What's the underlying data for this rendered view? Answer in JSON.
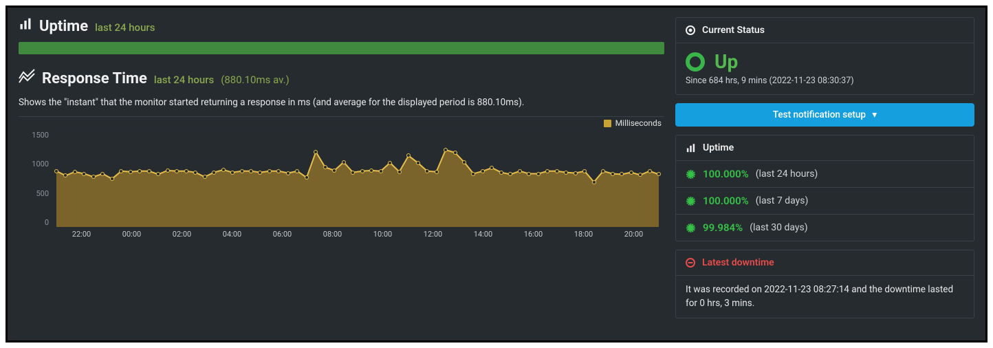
{
  "uptime_section": {
    "title": "Uptime",
    "subtitle": "last 24 hours"
  },
  "response_time": {
    "title": "Response Time",
    "subtitle": "last 24 hours",
    "avg_label": "(880.10ms av.)",
    "description": "Shows the \"instant\" that the monitor started returning a response in ms (and average for the displayed period is 880.10ms).",
    "legend": "Milliseconds"
  },
  "status_card": {
    "header": "Current Status",
    "state": "Up",
    "since": "Since 684 hrs, 9 mins (2022-11-23 08:30:37)"
  },
  "test_button": "Test notification setup",
  "uptime_card": {
    "header": "Uptime",
    "rows": [
      {
        "pct": "100.000%",
        "range": "(last 24 hours)"
      },
      {
        "pct": "100.000%",
        "range": "(last 7 days)"
      },
      {
        "pct": "99.984%",
        "range": "(last 30 days)"
      }
    ]
  },
  "downtime_card": {
    "header": "Latest downtime",
    "body": "It was recorded on 2022-11-23 08:27:14 and the downtime lasted for 0 hrs, 3 mins."
  },
  "chart_data": {
    "type": "area",
    "xlabel": "",
    "ylabel": "",
    "ylim": [
      0,
      1500
    ],
    "y_ticks": [
      0,
      500,
      1000,
      1500
    ],
    "x_ticks": [
      "22:00",
      "00:00",
      "02:00",
      "04:00",
      "06:00",
      "08:00",
      "10:00",
      "12:00",
      "14:00",
      "16:00",
      "18:00",
      "20:00"
    ],
    "series": [
      {
        "name": "Milliseconds",
        "values": [
          870,
          800,
          860,
          830,
          780,
          830,
          750,
          870,
          860,
          870,
          870,
          820,
          880,
          870,
          870,
          850,
          780,
          850,
          890,
          850,
          870,
          870,
          850,
          870,
          870,
          840,
          870,
          770,
          1170,
          930,
          880,
          1010,
          850,
          870,
          880,
          870,
          1000,
          860,
          1110,
          1000,
          870,
          860,
          1200,
          1160,
          1010,
          830,
          870,
          920,
          850,
          820,
          870,
          830,
          830,
          870,
          870,
          850,
          840,
          870,
          700,
          870,
          830,
          820,
          850,
          810,
          870,
          820
        ]
      }
    ],
    "legend": "Milliseconds",
    "color_fill": "#8a6e2c",
    "color_line": "#e7be4b"
  }
}
